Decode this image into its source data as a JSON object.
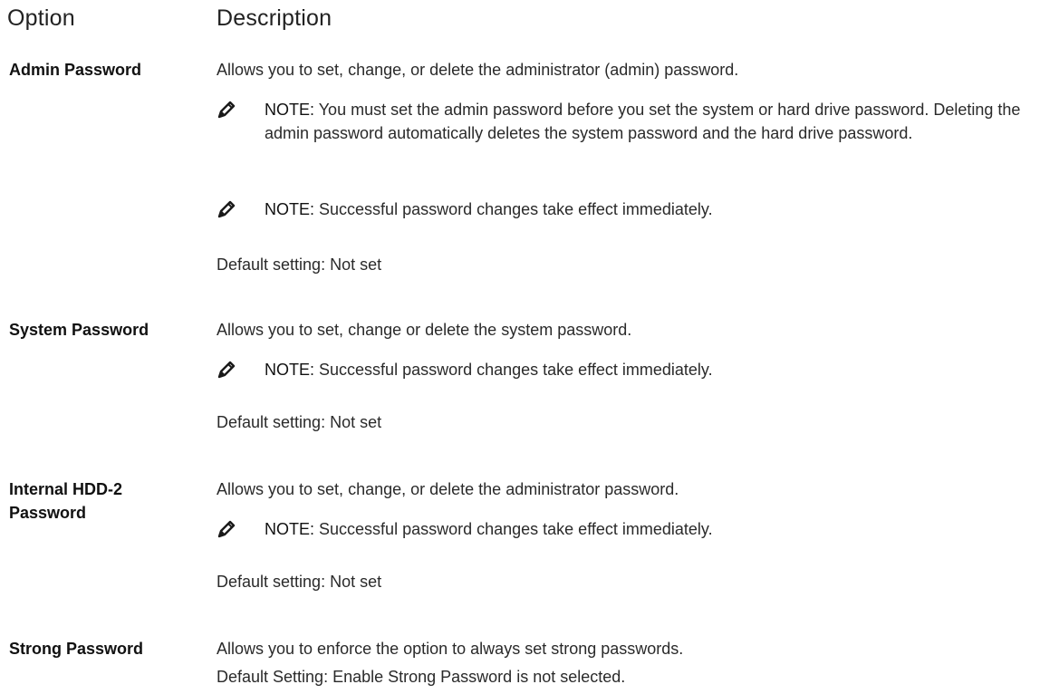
{
  "columns": {
    "option": "Option",
    "description": "Description"
  },
  "rows": [
    {
      "label": "Admin Password",
      "desc": "Allows you to set, change, or delete the administrator (admin) password.",
      "notes": [
        {
          "key": "NOTE:",
          "text": "You must set the admin password before you set the system or hard drive password. Deleting the admin password automatically deletes the system password and the hard drive password."
        },
        {
          "key": "NOTE:",
          "text": "Successful password changes take effect immediately."
        }
      ],
      "default": "Default setting: Not set"
    },
    {
      "label": "System Password",
      "desc": "Allows you to set, change or delete the system password.",
      "notes": [
        {
          "key": "NOTE:",
          "text": "Successful password changes take effect immediately."
        }
      ],
      "default": "Default setting: Not set"
    },
    {
      "label": "Internal HDD-2 Password",
      "desc": "Allows you to set, change, or delete the administrator password.",
      "notes": [
        {
          "key": "NOTE:",
          "text": "Successful password changes take effect immediately."
        }
      ],
      "default": "Default setting: Not set"
    },
    {
      "label": "Strong Password",
      "desc": "Allows you to enforce the option to always set strong passwords.",
      "notes": [],
      "default": "Default Setting: Enable Strong Password is not selected."
    }
  ],
  "note_icon": "pencil-note-icon"
}
